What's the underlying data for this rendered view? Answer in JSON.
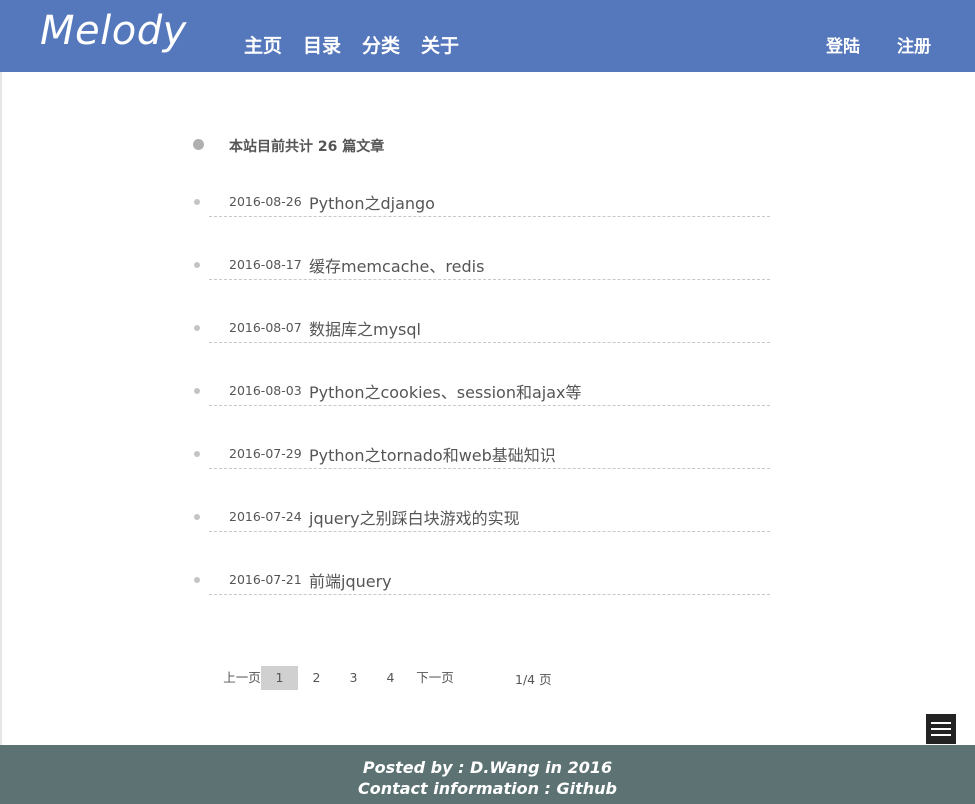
{
  "header": {
    "logo": "Melody",
    "nav": [
      "主页",
      "目录",
      "分类",
      "关于"
    ],
    "login": "登陆",
    "register": "注册"
  },
  "summary": "本站目前共计 26 篇文章",
  "posts": [
    {
      "date": "2016-08-26",
      "title": "Python之django"
    },
    {
      "date": "2016-08-17",
      "title": "缓存memcache、redis"
    },
    {
      "date": "2016-08-07",
      "title": "数据库之mysql"
    },
    {
      "date": "2016-08-03",
      "title": "Python之cookies、session和ajax等"
    },
    {
      "date": "2016-07-29",
      "title": "Python之tornado和web基础知识"
    },
    {
      "date": "2016-07-24",
      "title": "jquery之别踩白块游戏的实现"
    },
    {
      "date": "2016-07-21",
      "title": "前端jquery"
    }
  ],
  "pagination": {
    "prev": "上一页",
    "pages": [
      "1",
      "2",
      "3",
      "4"
    ],
    "current": "1",
    "next": "下一页",
    "count": "1/4 页"
  },
  "footer": {
    "posted_by": "Posted by :  D.Wang in 2016",
    "contact": "Contact information : Github"
  },
  "icons": {
    "menu": "menu-icon",
    "back_to_top": "arrow-up-icon"
  },
  "colors": {
    "header_bg": "#5577bb",
    "footer_bg": "#5d7373"
  }
}
